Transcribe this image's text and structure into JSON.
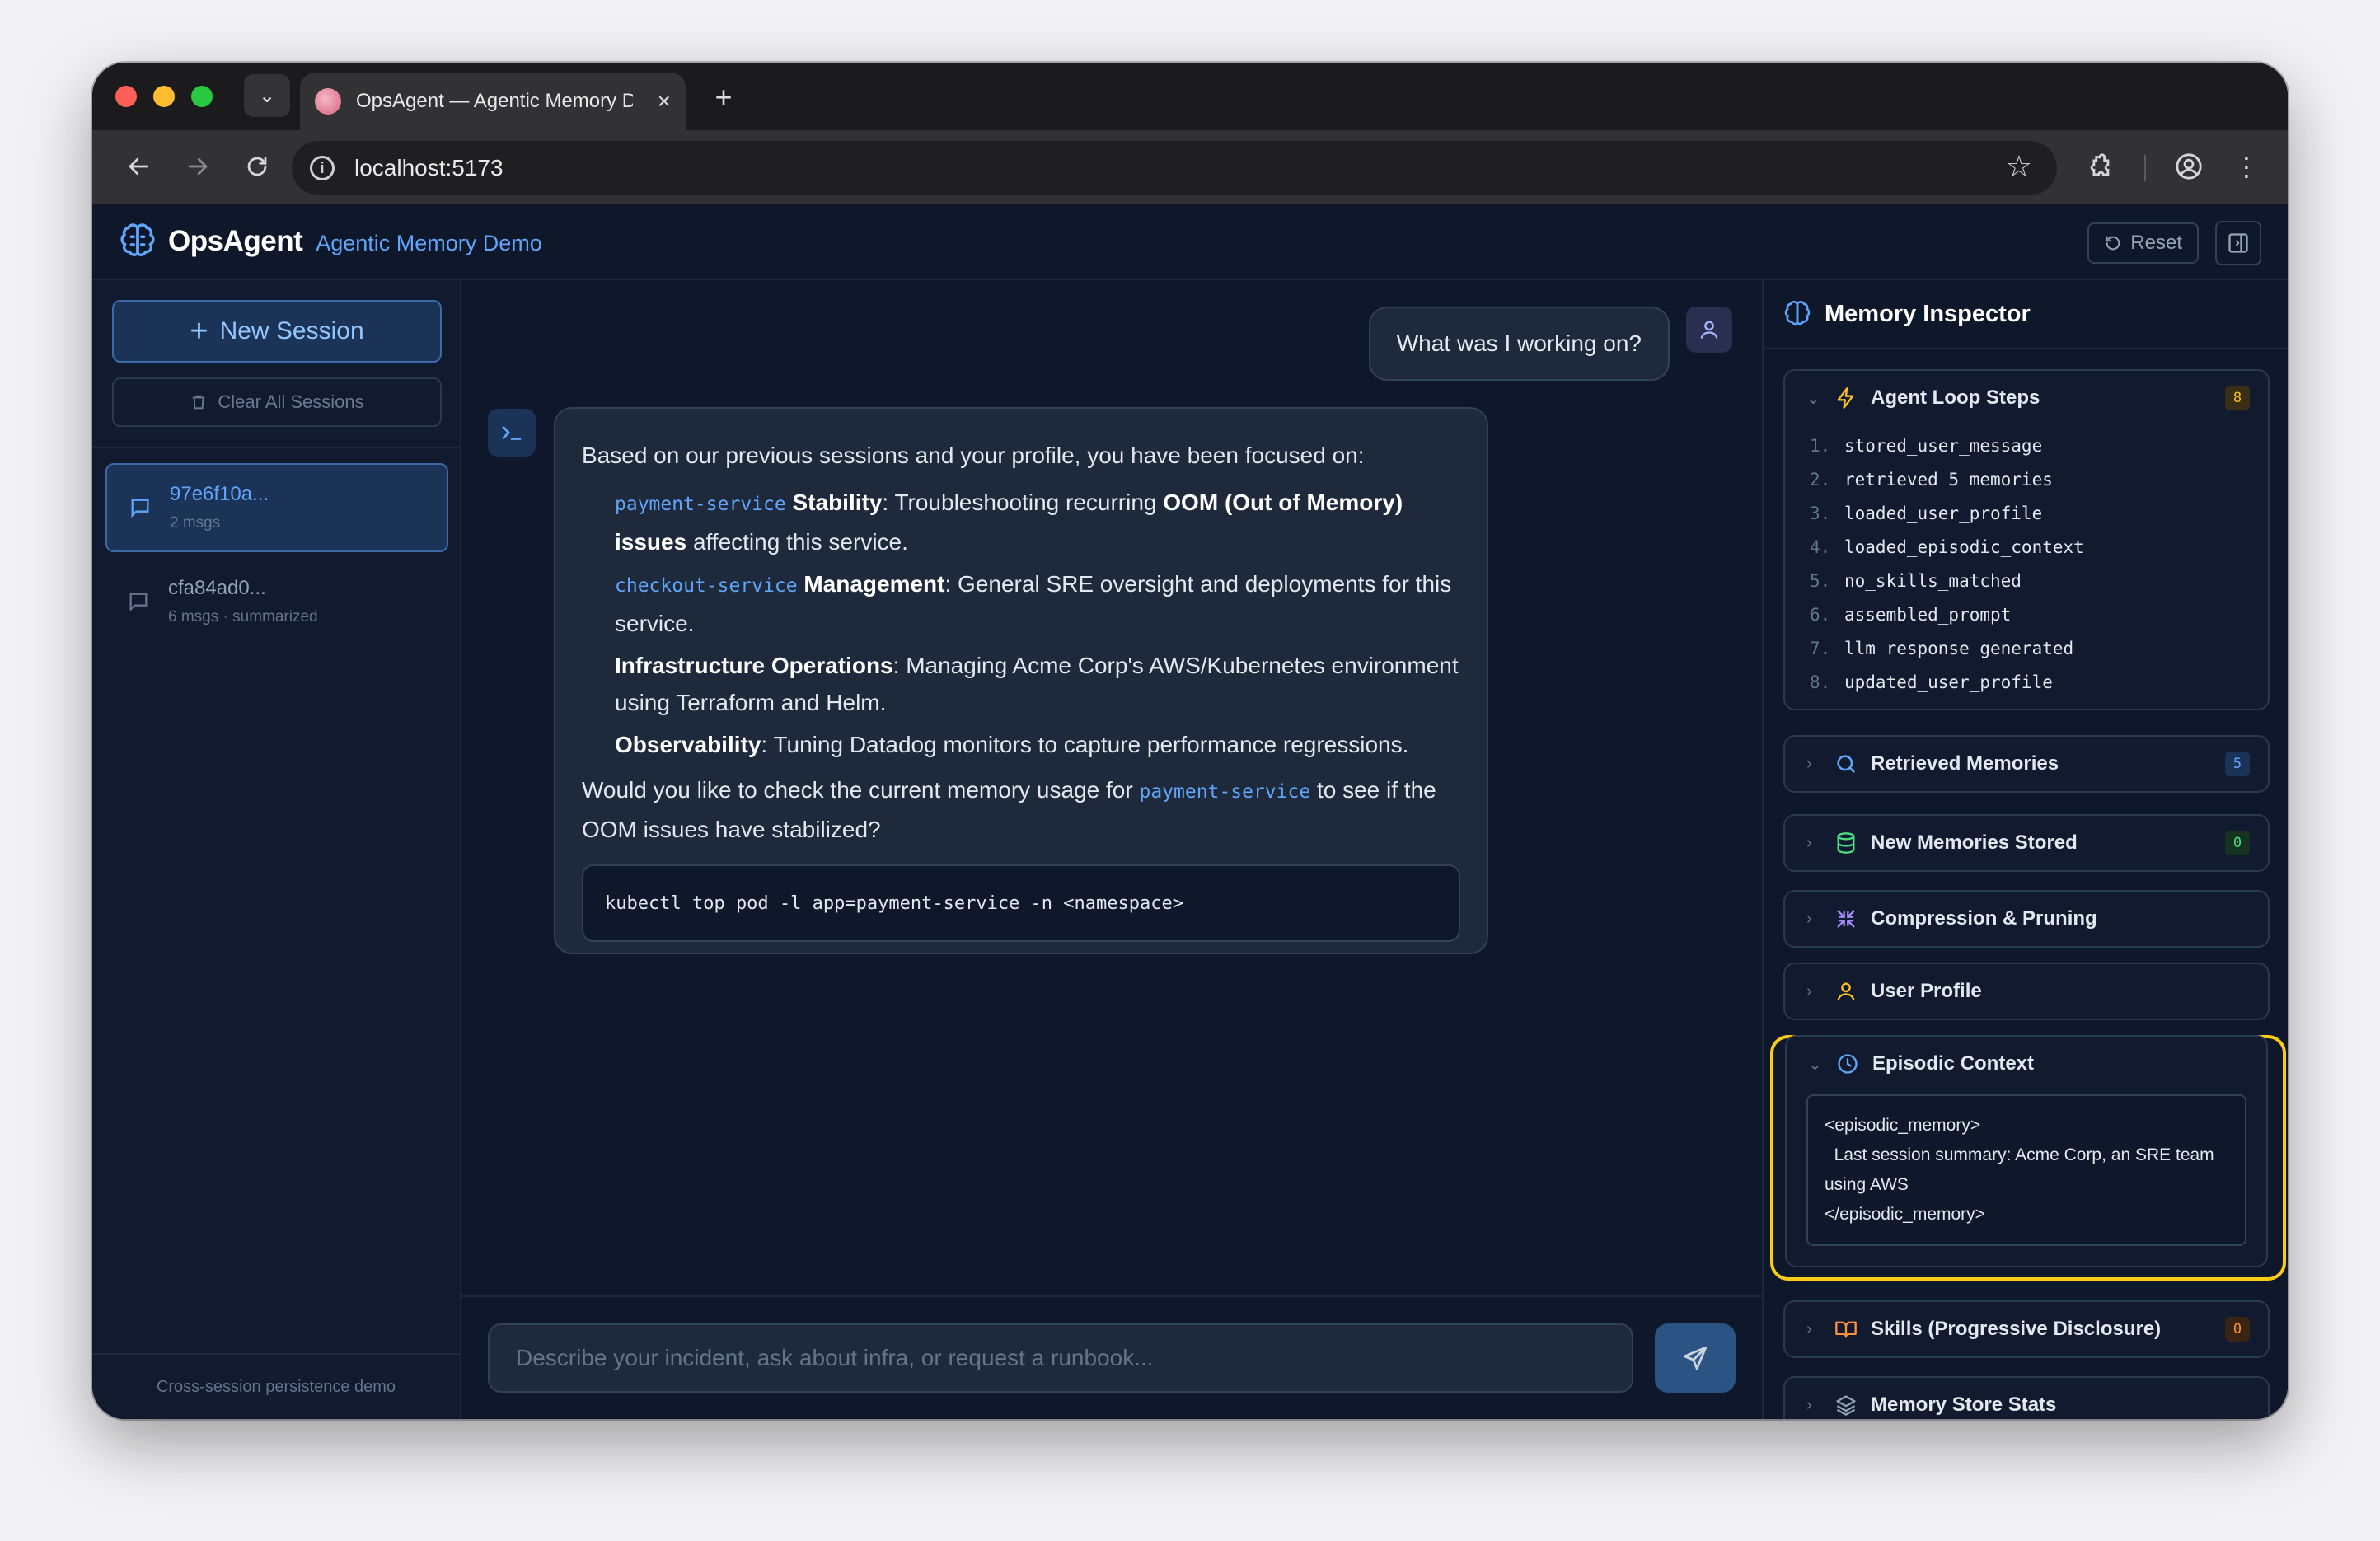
{
  "browser": {
    "tab_title": "OpsAgent — Agentic Memory Demo",
    "url": "localhost:5173"
  },
  "header": {
    "brand": "OpsAgent",
    "subtitle": "Agentic Memory Demo",
    "reset_label": "Reset"
  },
  "sidebar": {
    "new_session_label": "New Session",
    "clear_all_label": "Clear All Sessions",
    "sessions": [
      {
        "name": "97e6f10a...",
        "meta": "2 msgs",
        "active": true
      },
      {
        "name": "cfa84ad0...",
        "meta": "6 msgs · summarized",
        "active": false
      }
    ],
    "footer": "Cross-session persistence demo"
  },
  "chat": {
    "user_message": "What was I working on?",
    "agent": {
      "intro": "Based on our previous sessions and your profile, you have been focused on:",
      "items": [
        {
          "code": "payment-service",
          "bold": "Stability",
          "pre": ": Troubleshooting recurring ",
          "bold2": "OOM (Out of Memory) issues",
          "post": " affecting this service."
        },
        {
          "code": "checkout-service",
          "bold": "Management",
          "pre": ": General SRE oversight and deployments for this service."
        },
        {
          "bold": "Infrastructure Operations",
          "pre": ": Managing Acme Corp's AWS/Kubernetes environment using Terraform and Helm."
        },
        {
          "bold": "Observability",
          "pre": ": Tuning Datadog monitors to capture performance regressions."
        }
      ],
      "outro_pre": "Would you like to check the current memory usage for ",
      "outro_code": "payment-service",
      "outro_post": " to see if the OOM issues have stabilized?",
      "code_block": "kubectl top pod -l app=payment-service -n <namespace>"
    },
    "input_placeholder": "Describe your incident, ask about infra, or request a runbook..."
  },
  "inspector": {
    "title": "Memory Inspector",
    "sections": {
      "agent_loop": {
        "label": "Agent Loop Steps",
        "badge": "8"
      },
      "retrieved": {
        "label": "Retrieved Memories",
        "badge": "5"
      },
      "new_stored": {
        "label": "New Memories Stored",
        "badge": "0"
      },
      "compression": {
        "label": "Compression & Pruning"
      },
      "user_profile": {
        "label": "User Profile"
      },
      "episodic": {
        "label": "Episodic Context",
        "content": "<episodic_memory>\n  Last session summary: Acme Corp, an SRE team using AWS\n</episodic_memory>"
      },
      "skills": {
        "label": "Skills (Progressive Disclosure)",
        "badge": "0"
      },
      "stats": {
        "label": "Memory Store Stats"
      }
    },
    "steps": [
      {
        "n": "1.",
        "name": "stored_user_message"
      },
      {
        "n": "2.",
        "name": "retrieved_5_memories"
      },
      {
        "n": "3.",
        "name": "loaded_user_profile"
      },
      {
        "n": "4.",
        "name": "loaded_episodic_context"
      },
      {
        "n": "5.",
        "name": "no_skills_matched"
      },
      {
        "n": "6.",
        "name": "assembled_prompt"
      },
      {
        "n": "7.",
        "name": "llm_response_generated"
      },
      {
        "n": "8.",
        "name": "updated_user_profile"
      }
    ]
  },
  "colors": {
    "accent": "#60a5fa",
    "background": "#0f172a",
    "highlight": "#facc15"
  }
}
